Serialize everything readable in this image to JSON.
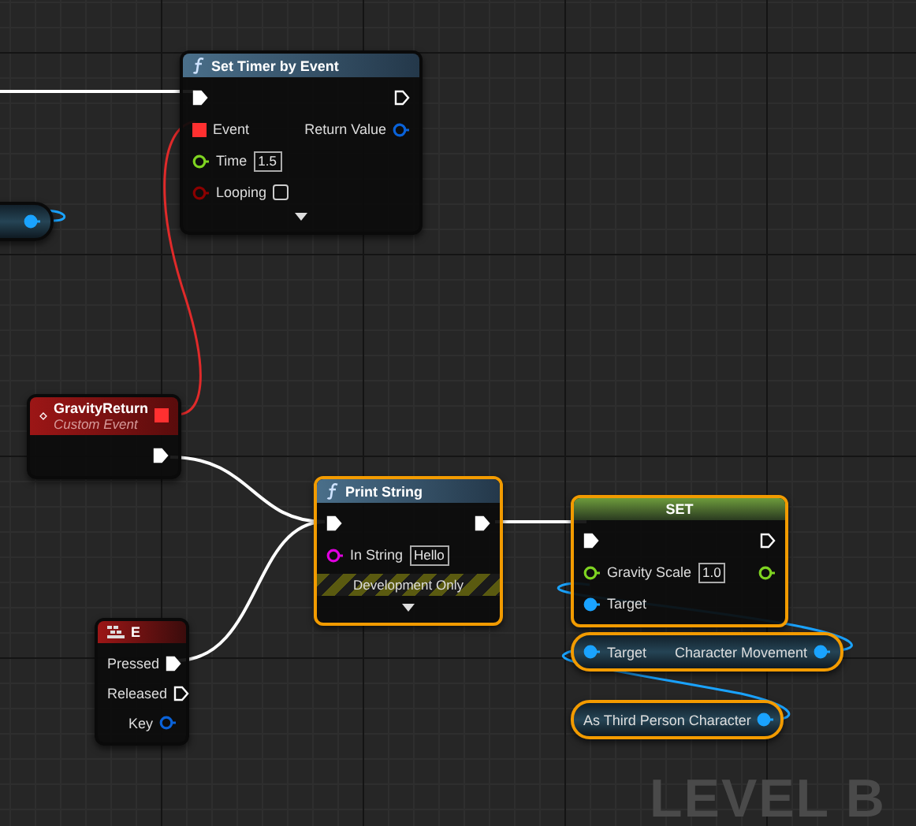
{
  "graph": {
    "label": "LEVEL B"
  },
  "nodes": [
    {
      "kind": "stub",
      "selected": false,
      "rows": [
        {
          "out": {
            "kind": "data",
            "color": "#1aa3ff",
            "connected": true
          }
        }
      ]
    },
    {
      "kind": "function",
      "title": "Set Timer by Event",
      "selected": false,
      "advanced": true,
      "rows": [
        {
          "in": {
            "kind": "exec",
            "connected": true
          },
          "out": {
            "kind": "exec",
            "connected": false
          }
        },
        {
          "in": {
            "kind": "delegate",
            "label": "Event",
            "color": "#ff3030",
            "connected": true
          },
          "out": {
            "kind": "data",
            "label": "Return Value",
            "color": "#0a62d8",
            "connected": false
          }
        },
        {
          "in": {
            "kind": "data",
            "label": "Time",
            "color": "#7ed321",
            "connected": false,
            "value": "1.5"
          }
        },
        {
          "in": {
            "kind": "data",
            "label": "Looping",
            "color": "#8b0000",
            "connected": false,
            "checked": false
          }
        }
      ]
    },
    {
      "kind": "event",
      "title": "GravityReturn",
      "subtitle": "Custom Event",
      "selected": false,
      "delegate": {
        "color": "#ff3030",
        "connected": true
      },
      "rows": [
        {
          "out": {
            "kind": "exec",
            "connected": true
          }
        }
      ]
    },
    {
      "kind": "input_event",
      "title": "E",
      "selected": false,
      "rows": [
        {
          "out": {
            "kind": "exec",
            "label": "Pressed",
            "connected": true
          }
        },
        {
          "out": {
            "kind": "exec",
            "label": "Released",
            "connected": false
          }
        },
        {
          "out": {
            "kind": "data",
            "label": "Key",
            "color": "#0a62d8",
            "connected": false
          }
        }
      ]
    },
    {
      "kind": "function",
      "title": "Print String",
      "selected": true,
      "advanced": true,
      "development": "Development Only",
      "rows": [
        {
          "in": {
            "kind": "exec",
            "connected": true
          },
          "out": {
            "kind": "exec",
            "connected": true
          }
        },
        {
          "in": {
            "kind": "data",
            "label": "In String",
            "color": "#e000e0",
            "connected": false,
            "value": "Hello"
          }
        }
      ]
    },
    {
      "kind": "variable_set",
      "title": "SET",
      "selected": true,
      "rows": [
        {
          "in": {
            "kind": "exec",
            "connected": true
          },
          "out": {
            "kind": "exec",
            "connected": false
          }
        },
        {
          "in": {
            "kind": "data",
            "label": "Gravity Scale",
            "color": "#7ed321",
            "connected": false,
            "value": "1.0"
          },
          "out": {
            "kind": "data",
            "color": "#7ed321",
            "connected": false
          }
        },
        {
          "in": {
            "kind": "data",
            "label": "Target",
            "color": "#1aa3ff",
            "connected": true
          }
        }
      ]
    },
    {
      "kind": "pure",
      "selected": true,
      "rows": [
        {
          "in": {
            "kind": "data",
            "label": "Target",
            "color": "#1aa3ff",
            "connected": true
          },
          "out": {
            "kind": "data",
            "label": "Character Movement",
            "color": "#1aa3ff",
            "connected": true
          }
        }
      ]
    },
    {
      "kind": "pure",
      "selected": true,
      "rows": [
        {
          "out": {
            "kind": "data",
            "label": "As Third Person Character",
            "color": "#1aa3ff",
            "connected": true
          }
        }
      ]
    }
  ]
}
